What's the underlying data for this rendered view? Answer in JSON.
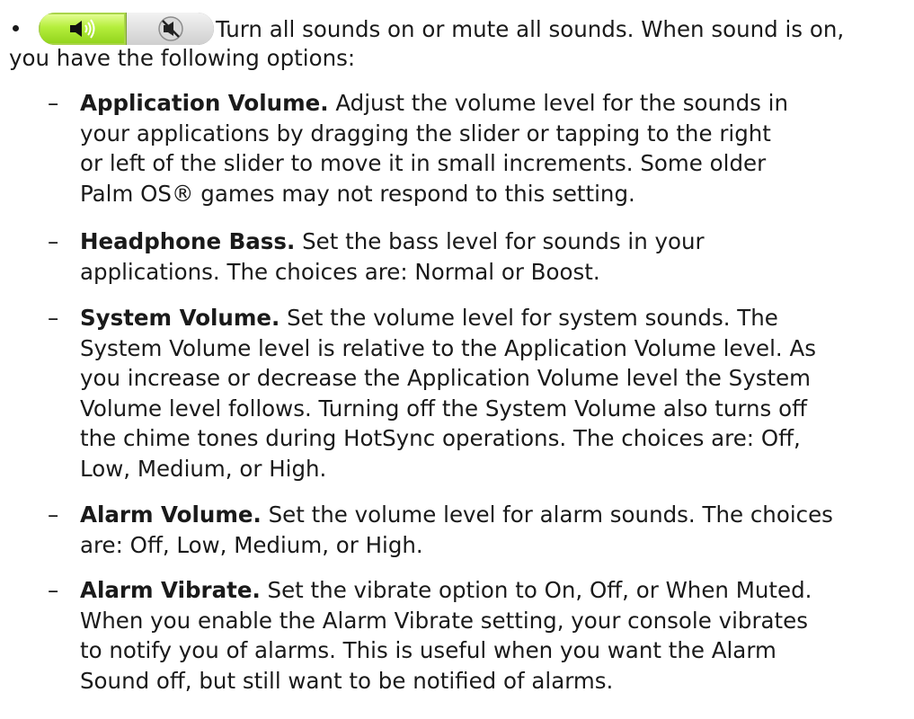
{
  "toggle": {
    "on_icon": "speaker-on-icon",
    "mute_icon": "speaker-mute-icon",
    "on_color": "#9ee02a"
  },
  "bullet": {
    "line1": "Turn all sounds on or mute all sounds. When sound is on,",
    "line2": "you have the following options:"
  },
  "items": [
    {
      "dash": "–",
      "term": "Application Volume.",
      "lines": [
        " Adjust the volume level for the sounds in",
        "your applications by dragging the slider or tapping to the right",
        "or left of the slider to move it in small increments. Some older",
        "Palm OS® games may not respond to this setting."
      ]
    },
    {
      "dash": "–",
      "term": "Headphone Bass.",
      "lines": [
        " Set the bass level for sounds in your",
        "applications. The choices are: Normal or Boost."
      ]
    },
    {
      "dash": "–",
      "term": "System Volume.",
      "lines": [
        " Set the volume level for system sounds. The",
        "System Volume level is relative to the Application Volume level. As",
        "you increase or decrease the Application Volume level the System",
        "Volume level follows. Turning off the System Volume also turns off",
        "the chime tones during HotSync operations. The choices are: Off,",
        "Low, Medium, or High."
      ]
    },
    {
      "dash": "–",
      "term": "Alarm Volume.",
      "lines": [
        " Set the volume level for alarm sounds. The choices",
        "are: Off, Low, Medium, or High."
      ]
    },
    {
      "dash": "–",
      "term": "Alarm Vibrate.",
      "lines": [
        " Set the vibrate option to On, Off, or When Muted.",
        "When you enable the Alarm Vibrate setting, your console vibrates",
        "to notify you of alarms. This is useful when you want the Alarm",
        "Sound off, but still want to be notified of alarms."
      ]
    }
  ]
}
